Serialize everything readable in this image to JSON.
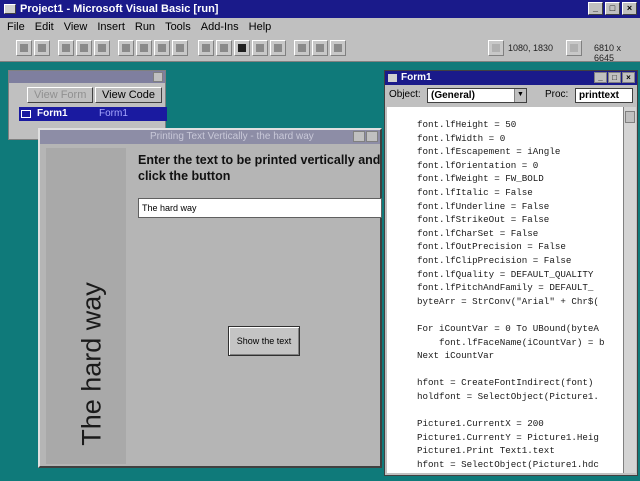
{
  "app": {
    "title": "Project1 - Microsoft Visual Basic [run]"
  },
  "menu": [
    "File",
    "Edit",
    "View",
    "Insert",
    "Run",
    "Tools",
    "Add-Ins",
    "Help"
  ],
  "toolbar": {
    "position_readout": "1080, 1830",
    "size_readout": "6810 x 6645"
  },
  "project_window": {
    "view_form_label": "View Form",
    "view_code_label": "View Code",
    "item_name": "Form1",
    "item_file": "Form1"
  },
  "form": {
    "caption": "Printing Text Vertically - the hard way",
    "vertical_text": "The hard way",
    "instruction": "Enter the text to be printed vertically and click the button",
    "input_value": "The hard way",
    "button_label": "Show the text"
  },
  "code_window": {
    "title": "Form1",
    "object_label": "Object:",
    "object_value": "(General)",
    "proc_label": "Proc:",
    "proc_value": "printtext",
    "lines": [
      "font.lfHeight = 50",
      "font.lfWidth = 0",
      "font.lfEscapement = iAngle",
      "font.lfOrientation = 0",
      "font.lfWeight = FW_BOLD",
      "font.lfItalic = False",
      "font.lfUnderline = False",
      "font.lfStrikeOut = False",
      "font.lfCharSet = False",
      "font.lfOutPrecision = False",
      "font.lfClipPrecision = False",
      "font.lfQuality = DEFAULT_QUALITY",
      "font.lfPitchAndFamily = DEFAULT_",
      "byteArr = StrConv(\"Arial\" + Chr$(",
      "",
      "For iCountVar = 0 To UBound(byteA",
      "    font.lfFaceName(iCountVar) = b",
      "Next iCountVar",
      "",
      "hfont = CreateFontIndirect(font)",
      "holdfont = SelectObject(Picture1.",
      "",
      "Picture1.CurrentX = 200",
      "Picture1.CurrentY = Picture1.Heig",
      "Picture1.Print Text1.text",
      "hfont = SelectObject(Picture1.hdc"
    ]
  }
}
